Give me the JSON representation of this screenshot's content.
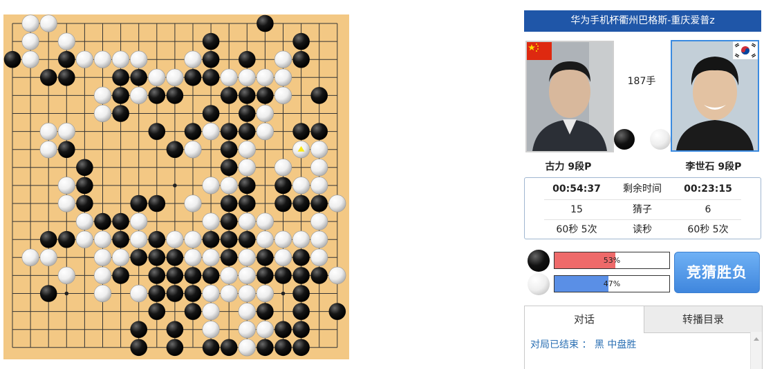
{
  "game": {
    "title": "华为手机杯衢州巴格斯-重庆爱普z",
    "move_count": "187手",
    "board_size": 19,
    "black_stones": [
      [
        14,
        0
      ],
      [
        1,
        1
      ],
      [
        11,
        1
      ],
      [
        16,
        1
      ],
      [
        0,
        2
      ],
      [
        3,
        2
      ],
      [
        11,
        2
      ],
      [
        13,
        2
      ],
      [
        16,
        2
      ],
      [
        2,
        3
      ],
      [
        3,
        3
      ],
      [
        6,
        3
      ],
      [
        7,
        3
      ],
      [
        10,
        3
      ],
      [
        11,
        3
      ],
      [
        6,
        4
      ],
      [
        8,
        4
      ],
      [
        9,
        4
      ],
      [
        12,
        4
      ],
      [
        13,
        4
      ],
      [
        14,
        4
      ],
      [
        17,
        4
      ],
      [
        6,
        5
      ],
      [
        11,
        5
      ],
      [
        13,
        5
      ],
      [
        8,
        6
      ],
      [
        10,
        6
      ],
      [
        12,
        6
      ],
      [
        13,
        6
      ],
      [
        16,
        6
      ],
      [
        17,
        6
      ],
      [
        3,
        7
      ],
      [
        9,
        7
      ],
      [
        12,
        7
      ],
      [
        4,
        8
      ],
      [
        12,
        8
      ],
      [
        4,
        9
      ],
      [
        13,
        9
      ],
      [
        15,
        9
      ],
      [
        4,
        10
      ],
      [
        7,
        10
      ],
      [
        8,
        10
      ],
      [
        12,
        10
      ],
      [
        13,
        10
      ],
      [
        15,
        10
      ],
      [
        16,
        10
      ],
      [
        17,
        10
      ],
      [
        5,
        11
      ],
      [
        6,
        11
      ],
      [
        12,
        11
      ],
      [
        2,
        12
      ],
      [
        3,
        12
      ],
      [
        6,
        12
      ],
      [
        8,
        12
      ],
      [
        11,
        12
      ],
      [
        12,
        12
      ],
      [
        13,
        12
      ],
      [
        7,
        13
      ],
      [
        8,
        13
      ],
      [
        9,
        13
      ],
      [
        12,
        13
      ],
      [
        14,
        13
      ],
      [
        16,
        13
      ],
      [
        6,
        14
      ],
      [
        8,
        14
      ],
      [
        9,
        14
      ],
      [
        10,
        14
      ],
      [
        11,
        14
      ],
      [
        14,
        14
      ],
      [
        15,
        14
      ],
      [
        16,
        14
      ],
      [
        17,
        14
      ],
      [
        2,
        15
      ],
      [
        8,
        15
      ],
      [
        9,
        15
      ],
      [
        10,
        15
      ],
      [
        16,
        15
      ],
      [
        8,
        16
      ],
      [
        10,
        16
      ],
      [
        14,
        16
      ],
      [
        16,
        16
      ],
      [
        18,
        16
      ],
      [
        7,
        17
      ],
      [
        9,
        17
      ],
      [
        15,
        17
      ],
      [
        16,
        17
      ],
      [
        7,
        18
      ],
      [
        9,
        18
      ],
      [
        11,
        18
      ],
      [
        12,
        18
      ],
      [
        14,
        18
      ],
      [
        15,
        18
      ],
      [
        16,
        18
      ]
    ],
    "white_stones": [
      [
        1,
        0
      ],
      [
        2,
        0
      ],
      [
        1,
        1
      ],
      [
        3,
        1
      ],
      [
        1,
        2
      ],
      [
        4,
        2
      ],
      [
        5,
        2
      ],
      [
        6,
        2
      ],
      [
        7,
        2
      ],
      [
        10,
        2
      ],
      [
        15,
        2
      ],
      [
        8,
        3
      ],
      [
        9,
        3
      ],
      [
        12,
        3
      ],
      [
        13,
        3
      ],
      [
        14,
        3
      ],
      [
        15,
        3
      ],
      [
        5,
        4
      ],
      [
        7,
        4
      ],
      [
        15,
        4
      ],
      [
        5,
        5
      ],
      [
        14,
        5
      ],
      [
        2,
        6
      ],
      [
        3,
        6
      ],
      [
        11,
        6
      ],
      [
        14,
        6
      ],
      [
        2,
        7
      ],
      [
        10,
        7
      ],
      [
        13,
        7
      ],
      [
        16,
        7
      ],
      [
        17,
        7
      ],
      [
        13,
        8
      ],
      [
        15,
        8
      ],
      [
        17,
        8
      ],
      [
        3,
        9
      ],
      [
        11,
        9
      ],
      [
        12,
        9
      ],
      [
        16,
        9
      ],
      [
        17,
        9
      ],
      [
        3,
        10
      ],
      [
        10,
        10
      ],
      [
        18,
        10
      ],
      [
        4,
        11
      ],
      [
        7,
        11
      ],
      [
        11,
        11
      ],
      [
        13,
        11
      ],
      [
        14,
        11
      ],
      [
        17,
        11
      ],
      [
        4,
        12
      ],
      [
        5,
        12
      ],
      [
        7,
        12
      ],
      [
        9,
        12
      ],
      [
        10,
        12
      ],
      [
        14,
        12
      ],
      [
        15,
        12
      ],
      [
        16,
        12
      ],
      [
        17,
        12
      ],
      [
        1,
        13
      ],
      [
        2,
        13
      ],
      [
        5,
        13
      ],
      [
        6,
        13
      ],
      [
        10,
        13
      ],
      [
        11,
        13
      ],
      [
        13,
        13
      ],
      [
        15,
        13
      ],
      [
        17,
        13
      ],
      [
        3,
        14
      ],
      [
        5,
        14
      ],
      [
        12,
        14
      ],
      [
        13,
        14
      ],
      [
        18,
        14
      ],
      [
        5,
        15
      ],
      [
        7,
        15
      ],
      [
        11,
        15
      ],
      [
        12,
        15
      ],
      [
        13,
        15
      ],
      [
        14,
        15
      ],
      [
        11,
        16
      ],
      [
        13,
        16
      ],
      [
        11,
        17
      ],
      [
        13,
        17
      ],
      [
        14,
        17
      ],
      [
        13,
        18
      ]
    ],
    "last_move": [
      16,
      7
    ],
    "board_color": "#f3c884",
    "line_color": "#333333"
  },
  "players": {
    "black": {
      "name": "古力 9段P",
      "flag": "china-flag"
    },
    "white": {
      "name": "李世石 9段P",
      "flag": "korea-flag"
    }
  },
  "stats": {
    "black_time": "00:54:37",
    "time_label": "剩余时间",
    "white_time": "00:23:15",
    "black_guess": "15",
    "guess_label": "猜子",
    "white_guess": "6",
    "black_byoyomi": "60秒 5次",
    "byoyomi_label": "读秒",
    "white_byoyomi": "60秒 5次"
  },
  "prediction": {
    "black_pct_label": "53%",
    "white_pct_label": "47%",
    "black_fraction": 0.53,
    "white_fraction": 0.47,
    "black_color": "#ee6a6a",
    "white_color": "#5a8fe6",
    "button_label": "竞猜胜负"
  },
  "tabs": {
    "chat_label": "对话",
    "broadcast_label": "转播目录"
  },
  "chat": {
    "message": "对局已结束 ： 黑  中盘胜"
  }
}
